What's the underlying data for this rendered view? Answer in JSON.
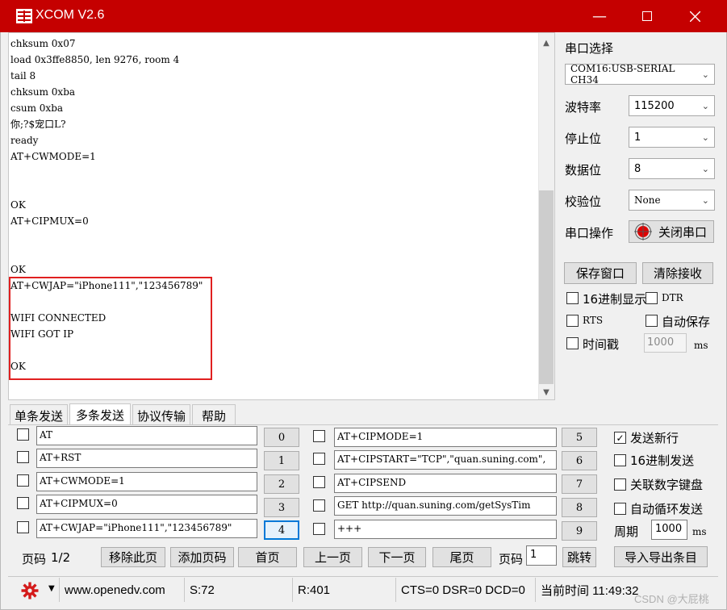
{
  "window": {
    "title": "XCOM V2.6"
  },
  "receive": {
    "lines": [
      "chksum 0x07",
      "load 0x3ffe8850, len 9276, room 4",
      "tail 8",
      "chksum 0xba",
      "csum 0xba",
      "你;?$宠口L?",
      "ready",
      "AT+CWMODE=1",
      "",
      "",
      "OK",
      "AT+CIPMUX=0",
      "",
      "",
      "OK",
      "AT+CWJAP=\"iPhone111\",\"123456789\"",
      "",
      "WIFI CONNECTED",
      "WIFI GOT IP",
      "",
      "OK"
    ]
  },
  "settings": {
    "port_title": "串口选择",
    "port_value": "COM16:USB-SERIAL CH34",
    "baud_label": "波特率",
    "baud_value": "115200",
    "stop_label": "停止位",
    "stop_value": "1",
    "data_label": "数据位",
    "data_value": "8",
    "parity_label": "校验位",
    "parity_value": "None",
    "op_label": "串口操作",
    "close_port": "关闭串口",
    "save_window": "保存窗口",
    "clear_recv": "清除接收",
    "hex_display": "16进制显示",
    "dtr": "DTR",
    "rts": "RTS",
    "auto_save": "自动保存",
    "timestamp": "时间戳",
    "timestamp_value": "1000",
    "ms": "ms"
  },
  "tabs": [
    "单条发送",
    "多条发送",
    "协议传输",
    "帮助"
  ],
  "multi_send": {
    "left": [
      {
        "text": "AT",
        "num": "0"
      },
      {
        "text": "AT+RST",
        "num": "1"
      },
      {
        "text": "AT+CWMODE=1",
        "num": "2"
      },
      {
        "text": "AT+CIPMUX=0",
        "num": "3"
      },
      {
        "text": "AT+CWJAP=\"iPhone111\",\"123456789\"",
        "num": "4"
      }
    ],
    "right": [
      {
        "text": "AT+CIPMODE=1",
        "num": "5"
      },
      {
        "text": "AT+CIPSTART=\"TCP\",\"quan.suning.com\",",
        "num": "6"
      },
      {
        "text": "AT+CIPSEND",
        "num": "7"
      },
      {
        "text": "GET http://quan.suning.com/getSysTim",
        "num": "8"
      },
      {
        "text": "+++",
        "num": "9"
      }
    ],
    "opt_newline": "发送新行",
    "opt_hex_send": "16进制发送",
    "opt_keypad": "关联数字键盘",
    "opt_autoloop": "自动循环发送",
    "period_label": "周期",
    "period_value": "1000",
    "period_unit": "ms",
    "page_label": "页码",
    "page_value": "1/2",
    "remove_page": "移除此页",
    "add_page": "添加页码",
    "home": "首页",
    "prev": "上一页",
    "next": "下一页",
    "last": "尾页",
    "page_label2": "页码",
    "page_input": "1",
    "jump": "跳转",
    "import_export": "导入导出条目"
  },
  "status": {
    "url": "www.openedv.com",
    "sent": "S:72",
    "received": "R:401",
    "lines": "CTS=0 DSR=0 DCD=0",
    "time": "当前时间 11:49:32",
    "watermark": "CSDN @大屁桃"
  },
  "colors": {
    "titlebar": "#c50000",
    "highlight": "#e02020",
    "focus": "#0078d7"
  }
}
